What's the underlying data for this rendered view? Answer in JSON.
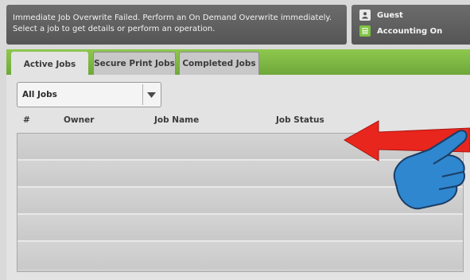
{
  "message": {
    "line1": "Immediate Job Overwrite Failed.  Perform an On Demand Overwrite immediately.",
    "line2": "Select a job to get details or perform an operation."
  },
  "user_panel": {
    "user_label": "Guest",
    "accounting_label": "Accounting On",
    "user_icon": "user-icon",
    "accounting_icon": "accounting-icon"
  },
  "tabs": [
    {
      "label": "Active Jobs",
      "selected": true
    },
    {
      "label": "Secure Print Jobs",
      "selected": false
    },
    {
      "label": "Completed Jobs",
      "selected": false
    }
  ],
  "filter": {
    "selected": "All Jobs"
  },
  "table": {
    "columns": [
      "#",
      "Owner",
      "Job Name",
      "Job Status"
    ],
    "rows": []
  },
  "colors": {
    "accent_green": "#7fb843",
    "annotation_arrow": "#e8261d",
    "annotation_hand": "#2f87cf"
  }
}
